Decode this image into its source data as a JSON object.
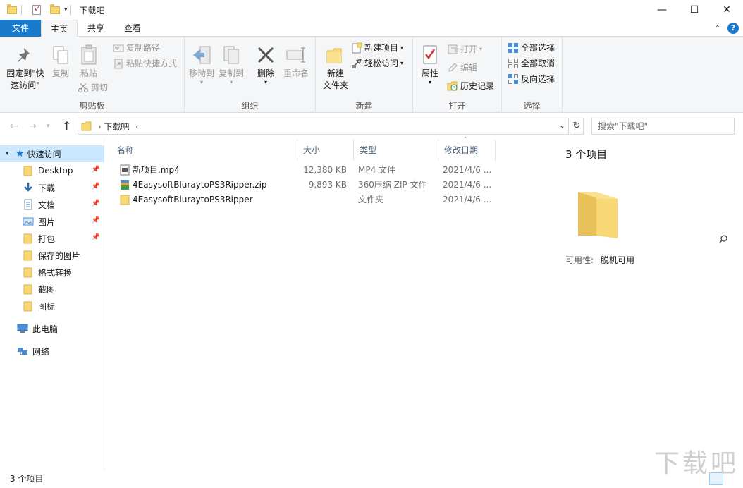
{
  "window": {
    "title": "下载吧",
    "controls": {
      "minimize": "—",
      "maximize": "☐",
      "close": "✕"
    }
  },
  "ribbon_tabs": [
    {
      "label": "文件"
    },
    {
      "label": "主页"
    },
    {
      "label": "共享"
    },
    {
      "label": "查看"
    }
  ],
  "ribbon": {
    "clipboard": {
      "pin_label_1": "固定到\"快",
      "pin_label_2": "速访问\"",
      "copy": "复制",
      "paste": "粘贴",
      "copy_path": "复制路径",
      "paste_shortcut": "粘贴快捷方式",
      "cut": "剪切",
      "group": "剪贴板"
    },
    "organize": {
      "move_to": "移动到",
      "copy_to": "复制到",
      "delete": "删除",
      "rename": "重命名",
      "group": "组织"
    },
    "new": {
      "new_folder_1": "新建",
      "new_folder_2": "文件夹",
      "new_item": "新建项目",
      "easy_access": "轻松访问",
      "group": "新建"
    },
    "open": {
      "properties": "属性",
      "open": "打开",
      "edit": "编辑",
      "history": "历史记录",
      "group": "打开"
    },
    "select": {
      "select_all": "全部选择",
      "select_none": "全部取消",
      "invert": "反向选择",
      "group": "选择"
    }
  },
  "address": {
    "crumb": "下载吧",
    "search_placeholder": "搜索\"下载吧\""
  },
  "nav_pane": {
    "quick_access": "快速访问",
    "items": [
      {
        "label": "Desktop",
        "pinned": true,
        "icon": "folder-icon"
      },
      {
        "label": "下载",
        "pinned": true,
        "icon": "download-icon"
      },
      {
        "label": "文档",
        "pinned": true,
        "icon": "document-icon"
      },
      {
        "label": "图片",
        "pinned": true,
        "icon": "picture-icon"
      },
      {
        "label": "打包",
        "pinned": true,
        "icon": "folder-icon"
      },
      {
        "label": "保存的图片",
        "pinned": false,
        "icon": "folder-icon"
      },
      {
        "label": "格式转换",
        "pinned": false,
        "icon": "folder-icon"
      },
      {
        "label": "截图",
        "pinned": false,
        "icon": "folder-icon"
      },
      {
        "label": "图标",
        "pinned": false,
        "icon": "folder-icon"
      }
    ],
    "this_pc": "此电脑",
    "network": "网络"
  },
  "columns": {
    "name": "名称",
    "size": "大小",
    "type": "类型",
    "modified": "修改日期"
  },
  "files": [
    {
      "name": "新项目.mp4",
      "size": "12,380 KB",
      "type": "MP4 文件",
      "modified": "2021/4/6 ...",
      "icon": "video-file-icon"
    },
    {
      "name": "4EasysoftBluraytoPS3Ripper.zip",
      "size": "9,893 KB",
      "type": "360压缩 ZIP 文件",
      "modified": "2021/4/6 ...",
      "icon": "zip-file-icon"
    },
    {
      "name": "4EasysoftBluraytoPS3Ripper",
      "size": "",
      "type": "文件夹",
      "modified": "2021/4/6 ...",
      "icon": "folder-icon"
    }
  ],
  "preview": {
    "count": "3 个项目",
    "availability_label": "可用性:",
    "availability_value": "脱机可用"
  },
  "status": {
    "count": "3 个项目"
  },
  "watermark": "下载吧",
  "colors": {
    "accent": "#1979ca",
    "folder": "#f8d775",
    "selection": "#cce8ff"
  }
}
